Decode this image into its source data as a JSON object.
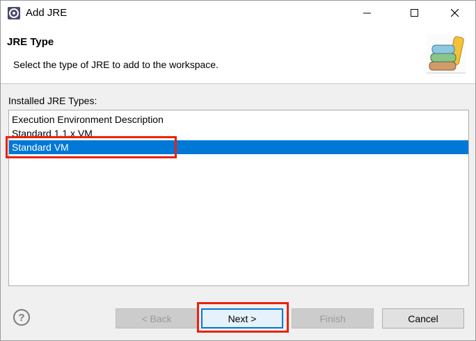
{
  "window": {
    "title": "Add JRE",
    "controls": {
      "minimize": "minimize",
      "maximize": "maximize",
      "close": "close"
    }
  },
  "banner": {
    "title": "JRE Type",
    "description": "Select the type of JRE to add to the workspace."
  },
  "list": {
    "label": "Installed JRE Types:",
    "items": [
      {
        "label": "Execution Environment Description",
        "selected": false
      },
      {
        "label": "Standard 1.1.x VM",
        "selected": false
      },
      {
        "label": "Standard VM",
        "selected": true
      }
    ]
  },
  "footer": {
    "help": "?",
    "back": "< Back",
    "next": "Next >",
    "finish": "Finish",
    "cancel": "Cancel"
  },
  "colors": {
    "selection": "#0078d7",
    "highlight_box": "#e8220c"
  }
}
